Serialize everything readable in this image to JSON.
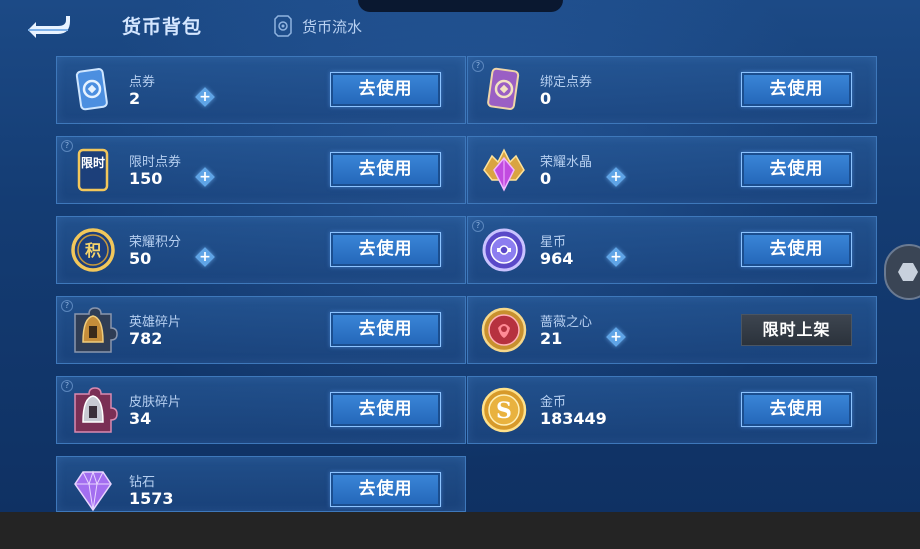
{
  "header": {
    "title": "货币背包",
    "flow_label": "货币流水"
  },
  "currencies": [
    {
      "name": "点券",
      "count": "2",
      "button": "去使用",
      "has_plus": true,
      "has_help": false
    },
    {
      "name": "绑定点券",
      "count": "0",
      "button": "去使用",
      "has_plus": false,
      "has_help": true
    },
    {
      "name": "限时点券",
      "count": "150",
      "button": "去使用",
      "has_plus": true,
      "has_help": true
    },
    {
      "name": "荣耀水晶",
      "count": "0",
      "button": "去使用",
      "has_plus": true,
      "has_help": false
    },
    {
      "name": "荣耀积分",
      "count": "50",
      "button": "去使用",
      "has_plus": true,
      "has_help": false
    },
    {
      "name": "星币",
      "count": "964",
      "button": "去使用",
      "has_plus": true,
      "has_help": true
    },
    {
      "name": "英雄碎片",
      "count": "782",
      "button": "去使用",
      "has_plus": false,
      "has_help": true
    },
    {
      "name": "蔷薇之心",
      "count": "21",
      "button": "限时上架",
      "has_plus": true,
      "has_help": false
    },
    {
      "name": "皮肤碎片",
      "count": "34",
      "button": "去使用",
      "has_plus": false,
      "has_help": true
    },
    {
      "name": "金币",
      "count": "183449",
      "button": "去使用",
      "has_plus": false,
      "has_help": false
    },
    {
      "name": "钻石",
      "count": "1573",
      "button": "去使用",
      "has_plus": false,
      "has_help": false
    }
  ],
  "icons": {
    "c0": "ticket-icon",
    "c1": "bound-ticket-icon",
    "c2": "limited-ticket-icon",
    "c3": "glory-crystal-icon",
    "c4": "glory-points-icon",
    "c5": "star-coin-icon",
    "c6": "hero-fragment-icon",
    "c7": "rose-heart-icon",
    "c8": "skin-fragment-icon",
    "c9": "gold-coin-icon",
    "c10": "diamond-icon"
  },
  "icon_text": {
    "limited": "限时",
    "points": "积",
    "gold": "S"
  },
  "help_glyph": "?",
  "plus_glyph": "+"
}
